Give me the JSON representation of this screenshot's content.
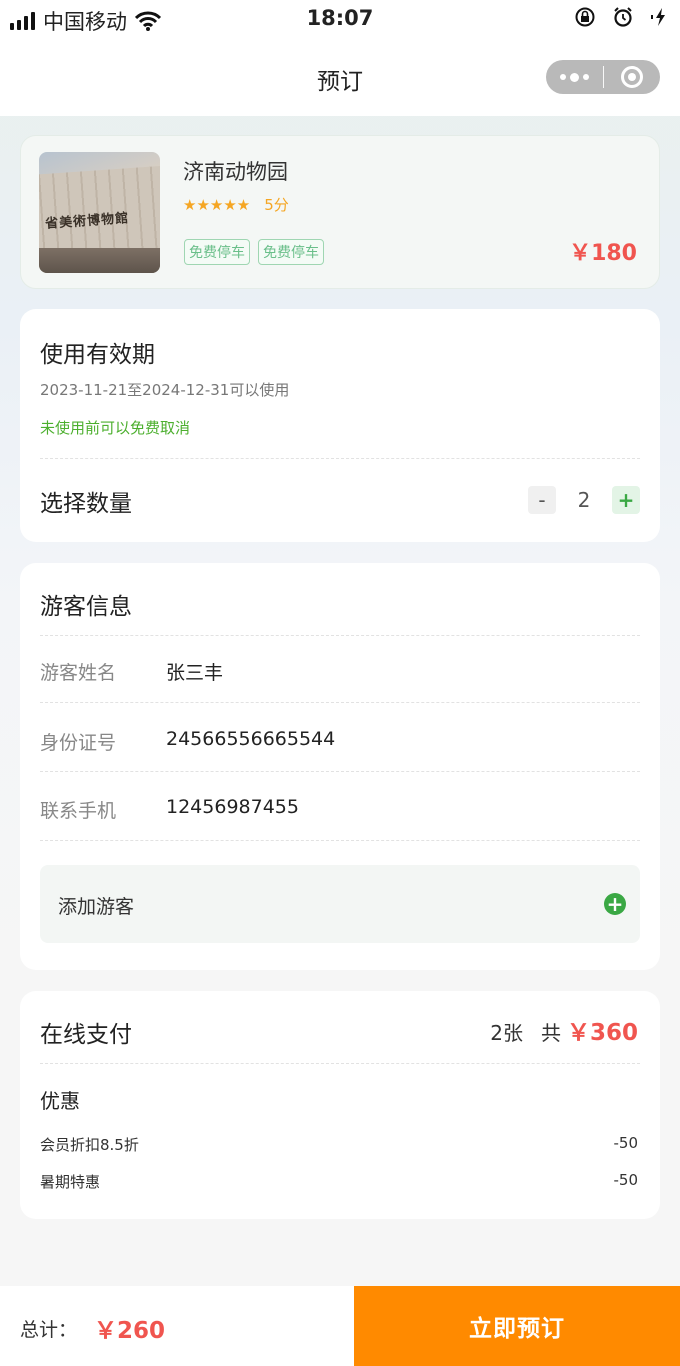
{
  "status_bar": {
    "carrier": "中国移动",
    "time": "18:07"
  },
  "nav": {
    "title": "预订"
  },
  "product": {
    "name": "济南动物园",
    "image_caption": "省美術博物館",
    "stars": "★★★★★",
    "score": "5分",
    "tags": [
      "免费停车",
      "免费停车"
    ],
    "price": "￥180"
  },
  "validity": {
    "title": "使用有效期",
    "date_range": "2023-11-21至2024-12-31可以使用",
    "cancel_note": "未使用前可以免费取消",
    "qty_label": "选择数量",
    "qty_minus": "-",
    "qty_value": "2",
    "qty_plus": "+"
  },
  "visitor": {
    "title": "游客信息",
    "fields": [
      {
        "label": "游客姓名",
        "value": "张三丰"
      },
      {
        "label": "身份证号",
        "value": "24566556665544"
      },
      {
        "label": "联系手机",
        "value": "12456987455"
      }
    ],
    "add_label": "添加游客",
    "add_icon": "+"
  },
  "payment": {
    "title": "在线支付",
    "count": "2张",
    "total_prefix": "共",
    "total": "￥360",
    "discount_title": "优惠",
    "discounts": [
      {
        "name": "会员折扣8.5折",
        "amount": "-50"
      },
      {
        "name": "暑期特惠",
        "amount": "-50"
      }
    ]
  },
  "bottom_bar": {
    "total_label": "总计：",
    "total": "￥260",
    "book_label": "立即预订"
  },
  "colors": {
    "accent_green": "#3aa844",
    "price_red": "#f0554f",
    "book_orange": "#ff8a00"
  }
}
